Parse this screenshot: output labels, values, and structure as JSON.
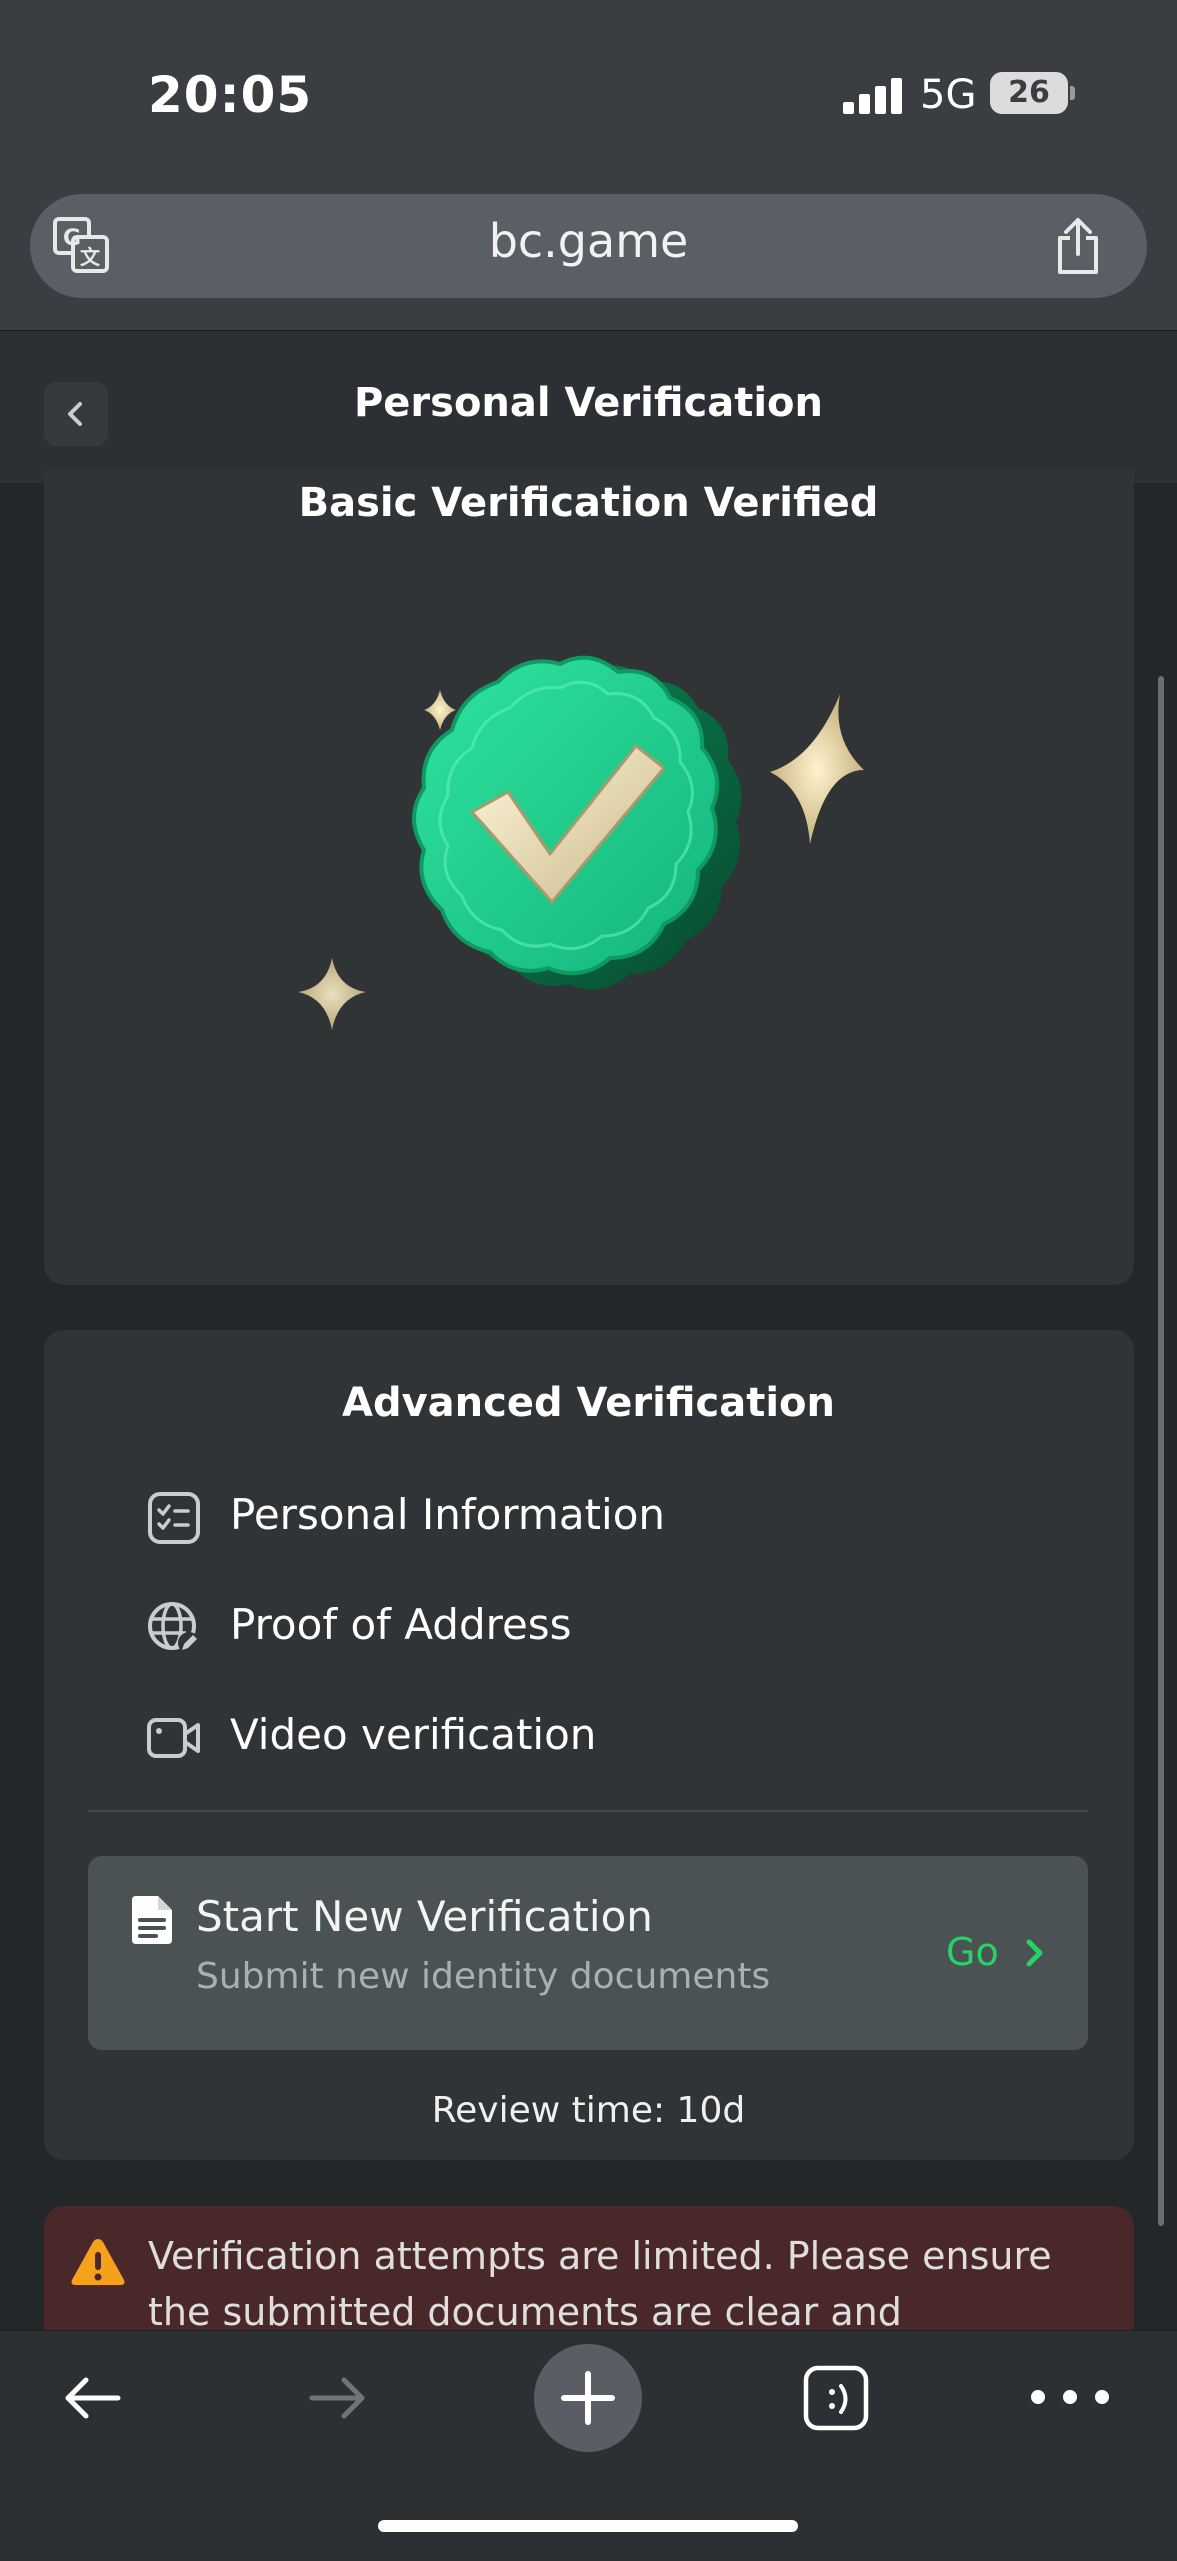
{
  "status_bar": {
    "time": "20:05",
    "network": "5G",
    "battery": "26"
  },
  "browser": {
    "url": "bc.game"
  },
  "header": {
    "title": "Personal Verification"
  },
  "basic": {
    "title": "Basic Verification Verified"
  },
  "advanced": {
    "title": "Advanced Verification",
    "items": [
      {
        "label": "Personal Information",
        "icon": "checklist-icon"
      },
      {
        "label": "Proof of Address",
        "icon": "globe-edit-icon"
      },
      {
        "label": "Video verification",
        "icon": "video-camera-icon"
      }
    ],
    "start": {
      "title": "Start New Verification",
      "subtitle": "Submit new identity documents",
      "go_label": "Go"
    },
    "review_time": "Review time: 10d"
  },
  "warning": {
    "text": "Verification attempts are limited. Please ensure the submitted documents are clear and authentic."
  },
  "colors": {
    "accent": "#25d366",
    "warning_bg": "#4a2829",
    "card_bg": "#303436"
  }
}
